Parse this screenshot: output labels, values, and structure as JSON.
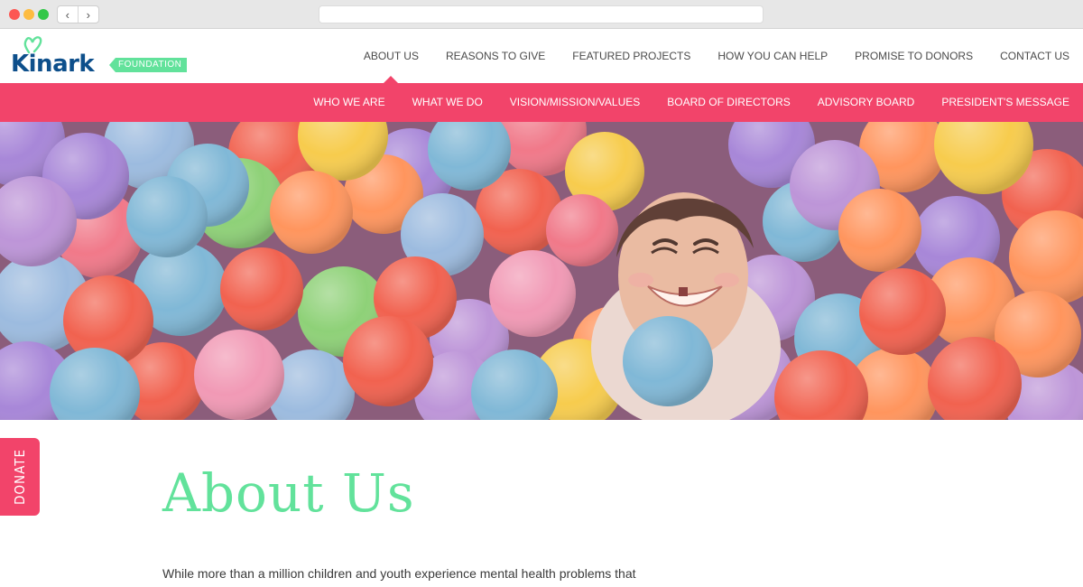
{
  "browser": {
    "back_glyph": "‹",
    "forward_glyph": "›",
    "url": ""
  },
  "logo": {
    "name": "Kinark",
    "tag": "FOUNDATION",
    "colors": {
      "word": "#0d4f8b",
      "tag": "#62e29b"
    }
  },
  "top_nav": [
    {
      "label": "ABOUT US",
      "active": true
    },
    {
      "label": "REASONS TO GIVE"
    },
    {
      "label": "FEATURED PROJECTS"
    },
    {
      "label": "HOW YOU CAN HELP"
    },
    {
      "label": "PROMISE TO DONORS"
    },
    {
      "label": "CONTACT US"
    }
  ],
  "sub_nav": [
    {
      "label": "WHO WE ARE"
    },
    {
      "label": "WHAT WE DO"
    },
    {
      "label": "VISION/MISSION/VALUES"
    },
    {
      "label": "BOARD OF DIRECTORS"
    },
    {
      "label": "ADVISORY BOARD"
    },
    {
      "label": "PRESIDENT'S MESSAGE"
    }
  ],
  "donate": {
    "label": "DONATE"
  },
  "page": {
    "title": "About Us",
    "intro": "While more than a million children and youth experience mental health problems that"
  },
  "colors": {
    "accent_pink": "#f2446a",
    "accent_green": "#62e29b",
    "brand_blue": "#0d4f8b"
  }
}
